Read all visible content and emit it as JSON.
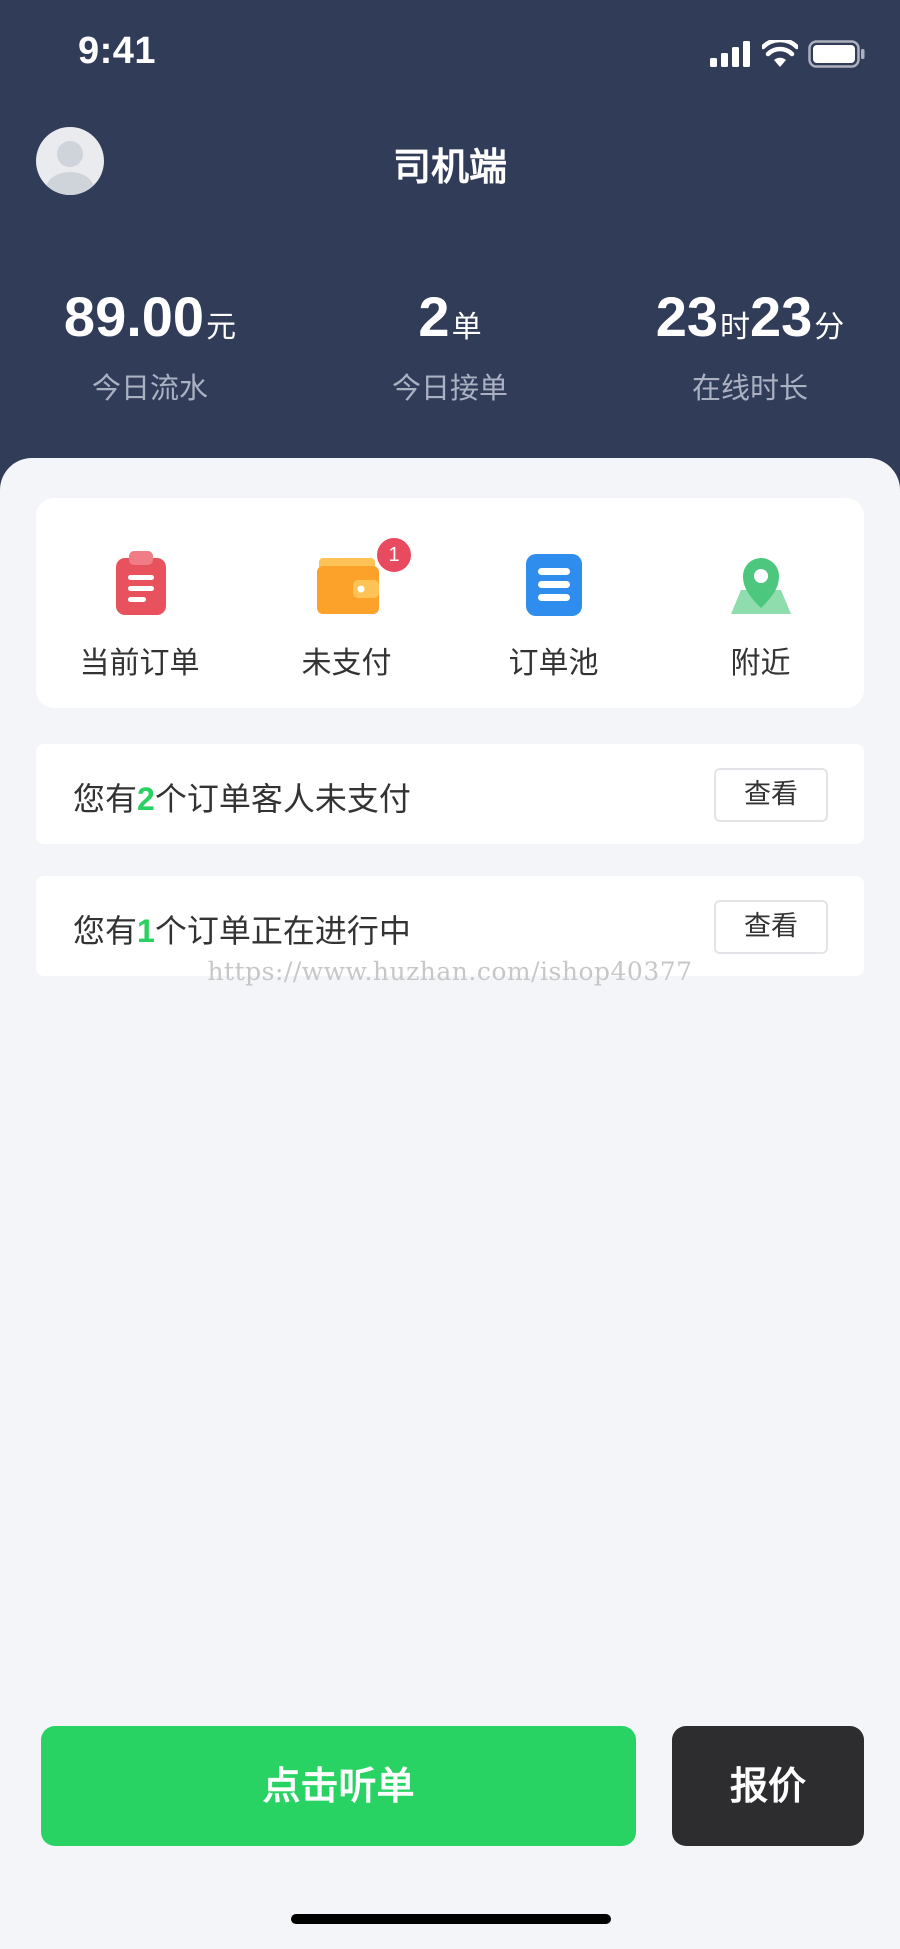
{
  "status_bar": {
    "time": "9:41",
    "signal_icon": "signal-icon",
    "wifi_icon": "wifi-icon",
    "battery_icon": "battery-icon"
  },
  "header": {
    "title": "司机端",
    "avatar_icon": "avatar-icon",
    "background": "#313c59"
  },
  "stats": {
    "revenue": {
      "value": "89.00",
      "unit": "元",
      "label": "今日流水"
    },
    "orders": {
      "value": "2",
      "unit": "单",
      "label": "今日接单"
    },
    "online": {
      "hours": "23",
      "hours_unit": "时",
      "minutes": "23",
      "minutes_unit": "分",
      "label": "在线时长"
    }
  },
  "menu": {
    "items": [
      {
        "label": "当前订单",
        "icon": "clipboard-icon",
        "color": "#e8525d"
      },
      {
        "label": "未支付",
        "icon": "wallet-icon",
        "color": "#fca12a",
        "badge": "1"
      },
      {
        "label": "订单池",
        "icon": "list-icon",
        "color": "#2f8eed"
      },
      {
        "label": "附近",
        "icon": "map-pin-icon",
        "color": "#4cc77d"
      }
    ]
  },
  "notices": [
    {
      "prefix": "您有",
      "count": "2",
      "suffix": "个订单客人未支付",
      "button": "查看"
    },
    {
      "prefix": "您有",
      "count": "1",
      "suffix": "个订单正在进行中",
      "button": "查看"
    }
  ],
  "watermark": "https://www.huzhan.com/ishop40377",
  "actions": {
    "listen": "点击听单",
    "quote": "报价",
    "listen_color": "#28d363",
    "quote_color": "#2d2d2f"
  },
  "colors": {
    "highlight": "#2bd063",
    "badge": "#e84a5f"
  }
}
